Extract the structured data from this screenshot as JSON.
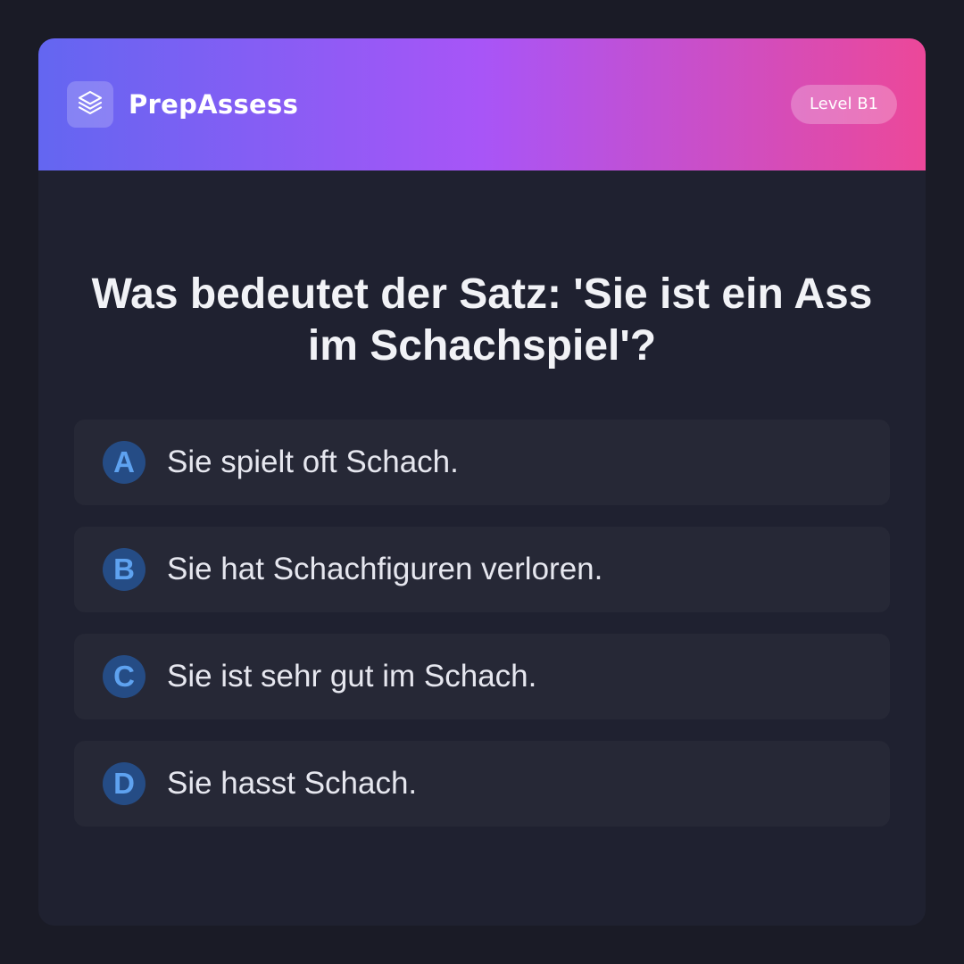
{
  "app": {
    "brand": "PrepAssess",
    "logo_icon": "layers-icon",
    "level_badge": "Level B1"
  },
  "colors": {
    "background": "#1a1b26",
    "card": "#1f2130",
    "option_bg": "#262836",
    "gradient_start": "#6366f1",
    "gradient_mid": "#a855f7",
    "gradient_end": "#ec4899",
    "letter_bg": "#254c85",
    "letter_fg": "#5ea2f0"
  },
  "quiz": {
    "question": "Was bedeutet der Satz: 'Sie ist ein Ass im Schachspiel'?",
    "options": [
      {
        "letter": "A",
        "text": "Sie spielt oft Schach."
      },
      {
        "letter": "B",
        "text": "Sie hat Schachfiguren verloren."
      },
      {
        "letter": "C",
        "text": "Sie ist sehr gut im Schach."
      },
      {
        "letter": "D",
        "text": "Sie hasst Schach."
      }
    ]
  }
}
